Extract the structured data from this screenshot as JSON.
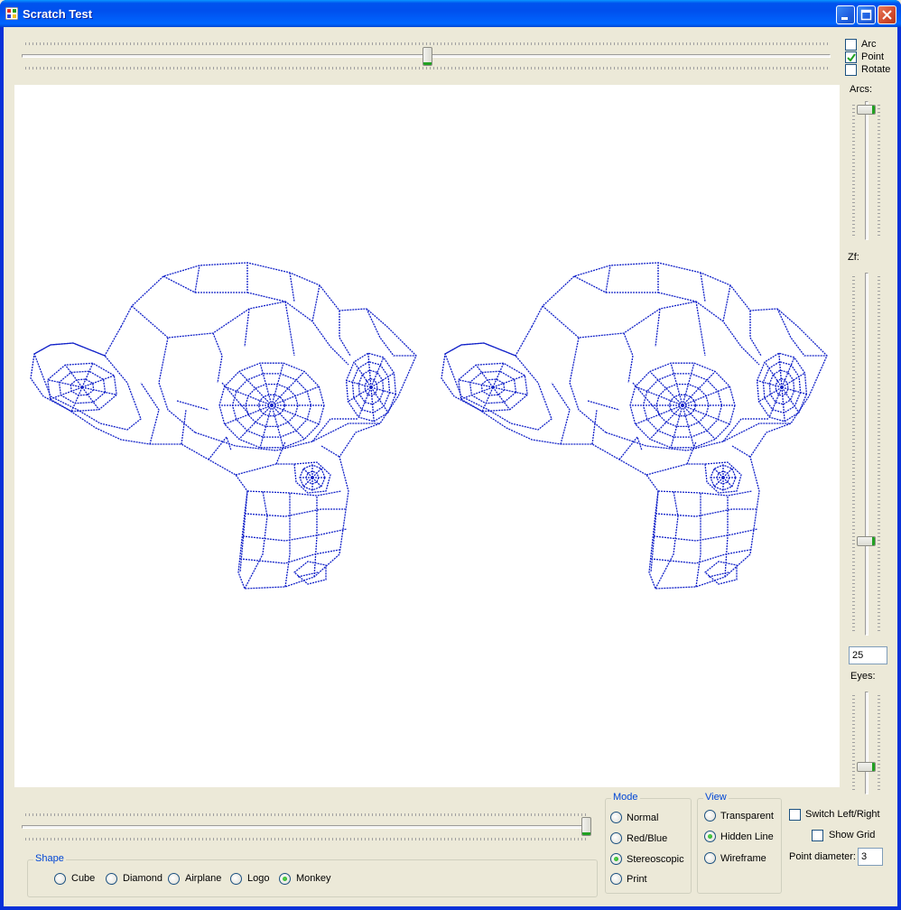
{
  "window": {
    "title": "Scratch Test"
  },
  "options": {
    "arc": {
      "label": "Arc",
      "checked": false
    },
    "point": {
      "label": "Point",
      "checked": true
    },
    "rotate": {
      "label": "Rotate",
      "checked": false
    }
  },
  "right_panel": {
    "arcs_label": "Arcs:",
    "zf_label": "Zf:",
    "zf_value": "25",
    "eyes_label": "Eyes:"
  },
  "mode": {
    "title": "Mode",
    "options": [
      "Normal",
      "Red/Blue",
      "Stereoscopic",
      "Print"
    ],
    "selected": "Stereoscopic"
  },
  "view": {
    "title": "View",
    "options": [
      "Transparent",
      "Hidden Line",
      "Wireframe"
    ],
    "selected": "Hidden Line"
  },
  "shape": {
    "title": "Shape",
    "options": [
      "Cube",
      "Diamond",
      "Airplane",
      "Logo",
      "Monkey"
    ],
    "selected": "Monkey"
  },
  "extras": {
    "switch_lr": {
      "label": "Switch Left/Right",
      "checked": false
    },
    "show_grid": {
      "label": "Show Grid",
      "checked": false
    },
    "point_diameter_label": "Point diameter:",
    "point_diameter_value": "3"
  },
  "colors": {
    "wireframe": "#1020c8",
    "accent": "#0046d5"
  }
}
